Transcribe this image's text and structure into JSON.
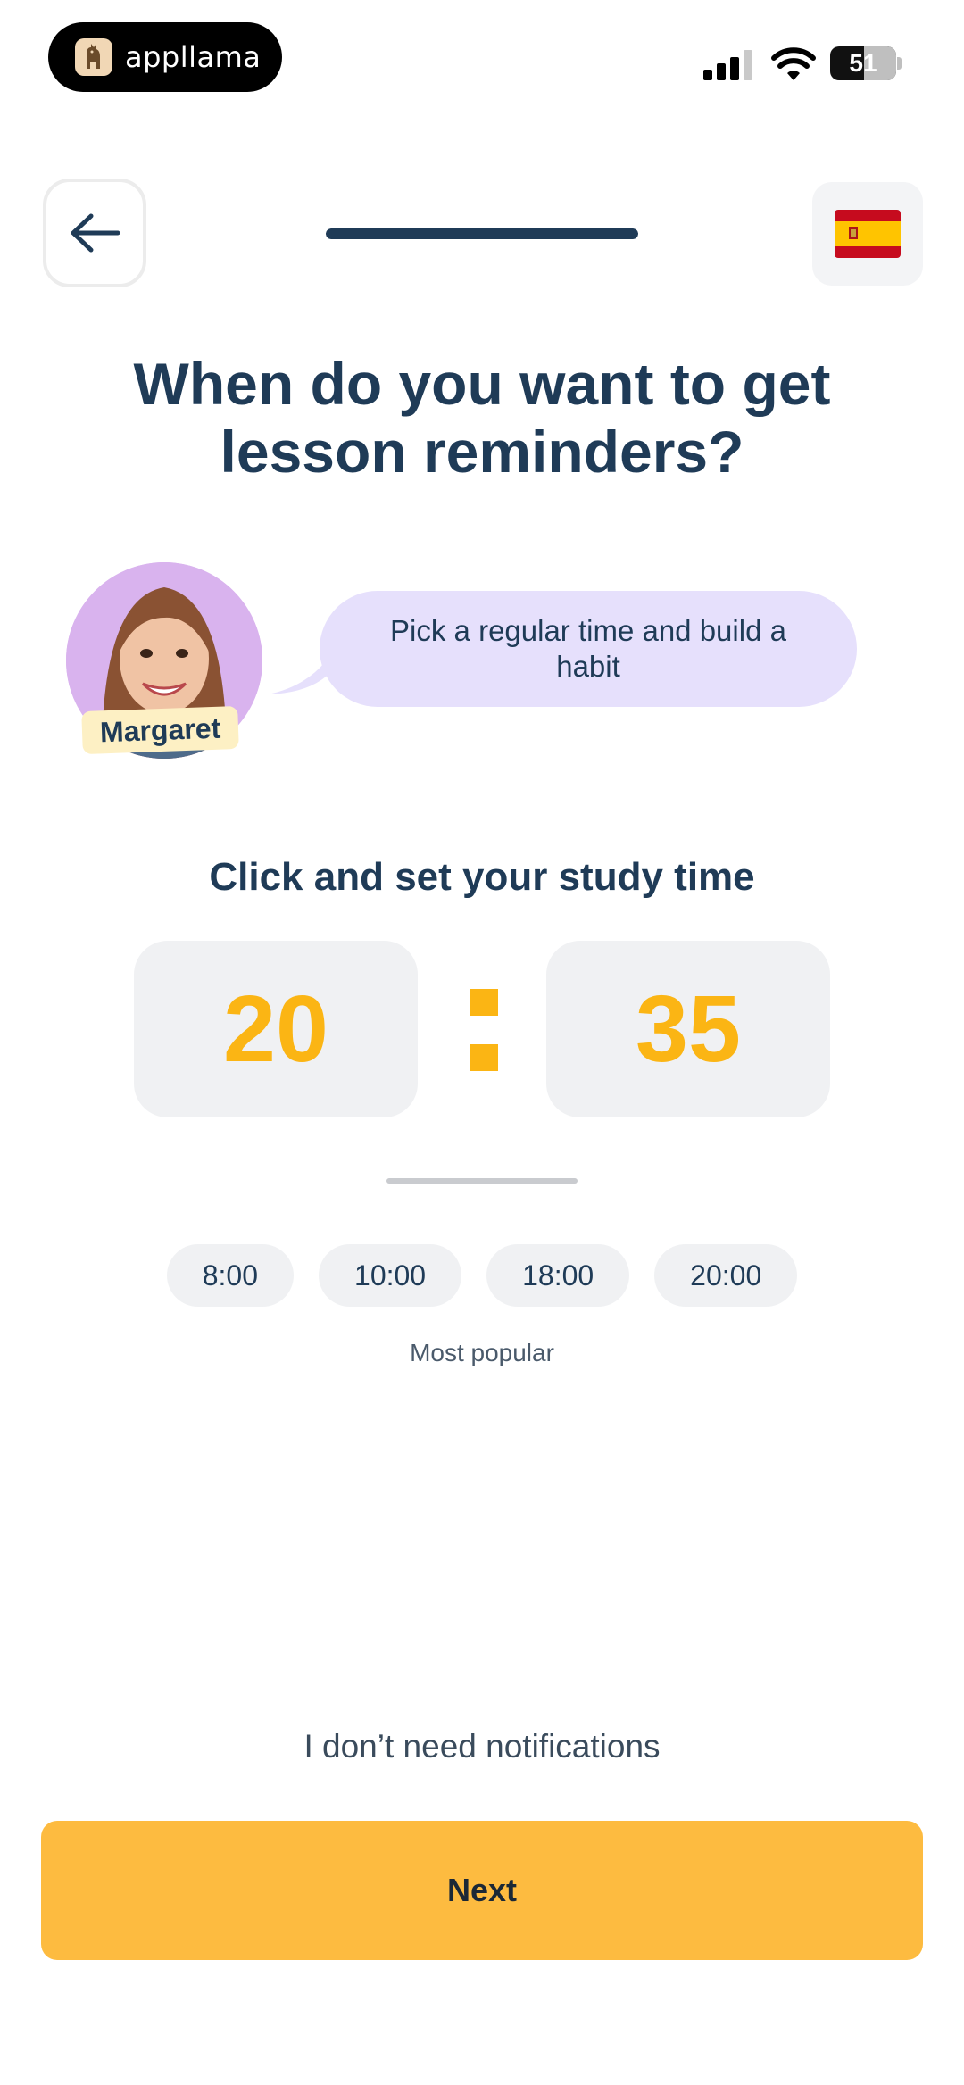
{
  "status_bar": {
    "app_name": "appllama",
    "battery": "51",
    "battery_level": 0.51
  },
  "nav": {
    "progress": 1.0,
    "language_flag": "spain-flag-icon"
  },
  "title": "When do you want to get lesson reminders?",
  "tutor": {
    "name": "Margaret",
    "message": "Pick a regular time and build a habit"
  },
  "time_picker": {
    "heading": "Click and set your study time",
    "hour": "20",
    "minute": "35"
  },
  "presets": {
    "options": [
      "8:00",
      "10:00",
      "18:00",
      "20:00"
    ],
    "caption": "Most popular"
  },
  "actions": {
    "skip_label": "I don’t need notifications",
    "next_label": "Next"
  },
  "colors": {
    "accent": "#fbb514",
    "button": "#fdbb40",
    "text": "#1f3b57",
    "bubble": "#e6e0fc"
  }
}
